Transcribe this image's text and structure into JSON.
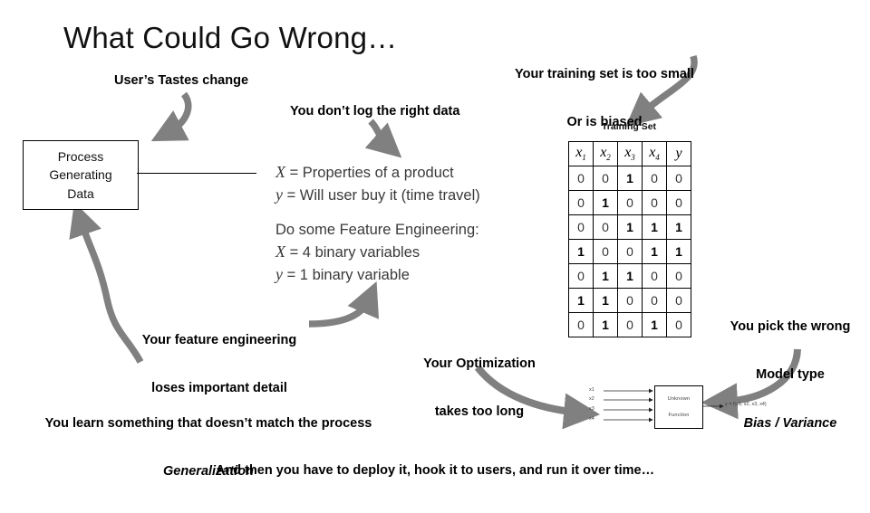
{
  "slide": {
    "title": "What Could Go Wrong…",
    "bottom_caption": "And then you have to deploy it, hook it to users, and run it over time…"
  },
  "annotations": {
    "users_tastes": "User’s Tastes change",
    "log_data": "You don’t log the right data",
    "training_small_line1": "Your training set is too small",
    "training_small_line2": "Or is biased",
    "feature_eng_line1": "Your feature engineering",
    "feature_eng_line2": "loses important detail",
    "optimization_line1": "Your Optimization",
    "optimization_line2": "takes too long",
    "model_type_line1": "You pick the wrong",
    "model_type_line2": "Model type",
    "model_type_line3": "Bias / Variance",
    "generalization_line1": "You learn something that doesn’t match the process",
    "generalization_line2": "Generalization"
  },
  "process_box": {
    "line1": "Process",
    "line2": "Generating",
    "line3": "Data"
  },
  "equations": {
    "block1": [
      {
        "var": "X",
        "text": " = Properties of a product"
      },
      {
        "var": "y",
        "text": " = Will user buy it (time travel)"
      }
    ],
    "block2_heading": "Do some Feature Engineering:",
    "block2": [
      {
        "var": "X",
        "text": " = 4 binary variables"
      },
      {
        "var": "y",
        "text": " = 1 binary variable"
      }
    ]
  },
  "training_set": {
    "label": "Training Set",
    "headers": [
      "x1",
      "x2",
      "x3",
      "x4",
      "y"
    ],
    "header_display": [
      {
        "base": "x",
        "sub": "1"
      },
      {
        "base": "x",
        "sub": "2"
      },
      {
        "base": "x",
        "sub": "3"
      },
      {
        "base": "x",
        "sub": "4"
      },
      {
        "base": "y",
        "sub": ""
      }
    ],
    "rows": [
      [
        "0",
        "0",
        "1",
        "0",
        "0"
      ],
      [
        "0",
        "1",
        "0",
        "0",
        "0"
      ],
      [
        "0",
        "0",
        "1",
        "1",
        "1"
      ],
      [
        "1",
        "0",
        "0",
        "1",
        "1"
      ],
      [
        "0",
        "1",
        "1",
        "0",
        "0"
      ],
      [
        "1",
        "1",
        "0",
        "0",
        "0"
      ],
      [
        "0",
        "1",
        "0",
        "1",
        "0"
      ]
    ]
  },
  "mini_diagram": {
    "inputs": [
      "x1",
      "x2",
      "x3",
      "x4"
    ],
    "box_line1": "Unknown",
    "box_line2": "Function",
    "output": "y = f(x1, x2, x3, x4)"
  },
  "colors": {
    "arrow_gray": "#808080",
    "text_black": "#000000",
    "equation_gray": "#3a3a3a"
  }
}
